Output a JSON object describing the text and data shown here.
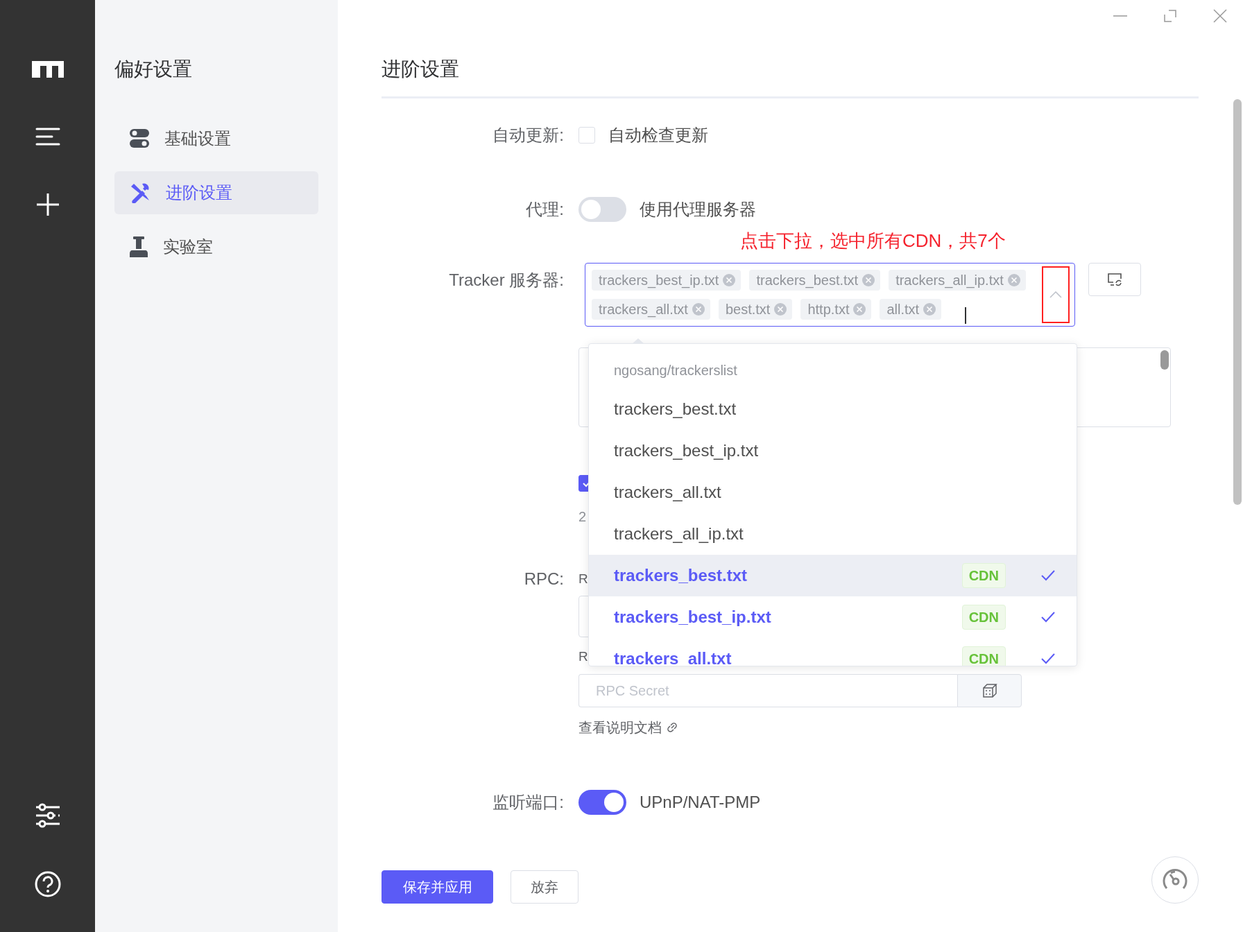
{
  "preferences": {
    "title": "偏好设置",
    "items": [
      {
        "label": "基础设置",
        "selected": false
      },
      {
        "label": "进阶设置",
        "selected": true
      },
      {
        "label": "实验室",
        "selected": false
      }
    ]
  },
  "page": {
    "title": "进阶设置"
  },
  "auto_update": {
    "label": "自动更新:",
    "option": "自动检查更新",
    "checked": false
  },
  "proxy": {
    "label": "代理:",
    "option": "使用代理服务器",
    "on": false
  },
  "annotation": "点击下拉，选中所有CDN，共7个",
  "tracker": {
    "label": "Tracker 服务器:",
    "expanded": true,
    "tags": [
      "trackers_best_ip.txt",
      "trackers_best.txt",
      "trackers_all_ip.txt",
      "trackers_all.txt",
      "best.txt",
      "http.txt",
      "all.txt"
    ],
    "dropdown": {
      "group": "ngosang/trackerslist",
      "options": [
        {
          "label": "trackers_best.txt",
          "selected": false,
          "highlighted": false
        },
        {
          "label": "trackers_best_ip.txt",
          "selected": false,
          "highlighted": false
        },
        {
          "label": "trackers_all.txt",
          "selected": false,
          "highlighted": false
        },
        {
          "label": "trackers_all_ip.txt",
          "selected": false,
          "highlighted": false
        },
        {
          "label": "trackers_best.txt",
          "badge": "CDN",
          "selected": true,
          "highlighted": true
        },
        {
          "label": "trackers_best_ip.txt",
          "badge": "CDN",
          "selected": true,
          "highlighted": false
        },
        {
          "label": "trackers_all.txt",
          "badge": "CDN",
          "selected": true,
          "highlighted": false
        }
      ]
    }
  },
  "tracker_extra": {
    "checked": true,
    "line_fragment": "2"
  },
  "rpc": {
    "label": "RPC:",
    "line_fragments": [
      "R",
      "R"
    ],
    "secret": {
      "placeholder": "RPC Secret"
    },
    "doc_link": "查看说明文档"
  },
  "listen_port": {
    "label": "监听端口:",
    "option": "UPnP/NAT-PMP",
    "on": true
  },
  "footer": {
    "buttons": [
      {
        "label": "保存并应用",
        "kind": "primary"
      },
      {
        "label": "放弃",
        "kind": "plain"
      }
    ]
  }
}
